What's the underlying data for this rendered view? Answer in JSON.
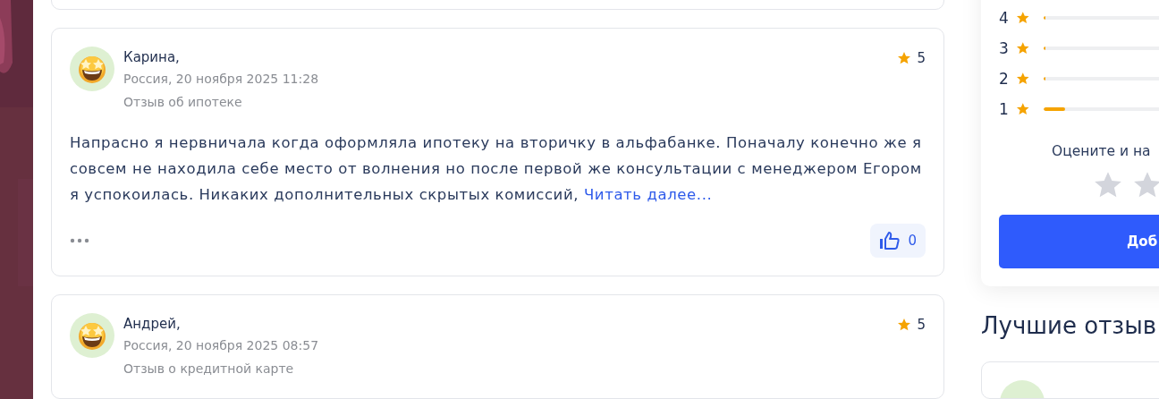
{
  "reviews": [
    {
      "name": "Карина,",
      "meta": "Россия, 20 ноября 2025 11:28",
      "topic": "Отзыв об ипотеке",
      "rating": "5",
      "text": "Напрасно я нервничала когда оформляла ипотеку на вторичку в альфабанке. Поначалу конечно же я совсем не находила себе место от волнения но после первой же консультации с менеджером Егором я успокоилась. Никаких дополнительных скрытых комиссий,",
      "link": "Читать далее...",
      "likes": "0"
    },
    {
      "name": "Андрей,",
      "meta": "Россия, 20 ноября 2025 08:57",
      "topic": "Отзыв о кредитной карте",
      "rating": "5"
    }
  ],
  "sidebar": {
    "distribution": [
      {
        "label": "4",
        "level": 0.01
      },
      {
        "label": "3",
        "level": 0.01
      },
      {
        "label": "2",
        "level": 0.01
      },
      {
        "label": "1",
        "level": 0.14
      }
    ],
    "prompt": "Оцените и на",
    "button": "Доб",
    "heading": "Лучшие отзыв"
  }
}
